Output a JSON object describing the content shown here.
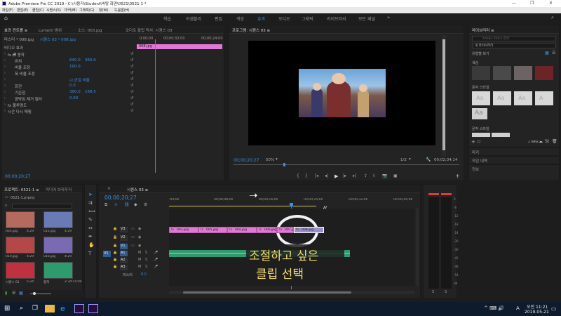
{
  "window": {
    "title": "Adobe Premiere Pro CC 2019 - C:\\사용자\\Student\\바탕 화면\\0521\\0521-1 *",
    "menu": [
      "파일(F)",
      "편집(E)",
      "클립(C)",
      "시퀀스(S)",
      "마커(M)",
      "그래픽(G)",
      "창(W)",
      "도움말(H)"
    ],
    "controls": [
      "—",
      "❐",
      "✕"
    ]
  },
  "workspaces": [
    "학습",
    "어셈블리",
    "편집",
    "색상",
    "효과",
    "오디오",
    "그래픽",
    "라이브러리",
    "모든 패널"
  ],
  "workspace_active": "효과",
  "effect_controls": {
    "tabs": [
      "효과 컨트롤 ≡",
      "Lumetri 범위",
      "소스: 003.jpg",
      "오디오 클립 믹서: 시퀀스 03"
    ],
    "breadcrumb": "마스터 * 008.jpg",
    "seq_breadcrumb": "시퀀스 03 * 008.jpg",
    "time_start": "0;00;00",
    "time_mid": "00;00;32;00",
    "time_end": "00;00;24;00",
    "clip_bar": "008.jpg",
    "section_video": "비디오 효과",
    "rows": [
      {
        "label": "fx 🗗 동작",
        "v1": "",
        "v2": ""
      },
      {
        "label": "위치",
        "v1": "640.0",
        "v2": "360.0"
      },
      {
        "label": "비율 조정",
        "v1": "100.0",
        "v2": ""
      },
      {
        "label": "폭 비율 조정",
        "v1": "",
        "v2": ""
      },
      {
        "label": "",
        "v1": "☑ 균일 비율",
        "v2": ""
      },
      {
        "label": "회전",
        "v1": "0.0",
        "v2": ""
      },
      {
        "label": "기준점",
        "v1": "300.0",
        "v2": "168.5"
      },
      {
        "label": "깜박임 제거 필터",
        "v1": "0.00",
        "v2": ""
      },
      {
        "label": "fx 불투명도",
        "v1": "",
        "v2": ""
      },
      {
        "label": "시간 다시 매핑",
        "v1": "",
        "v2": ""
      }
    ],
    "footer_time": "00;00;20;27"
  },
  "program": {
    "title": "프로그램: 시퀀스 03 ≡",
    "timecode": "00;00;20;27",
    "fit": "50%",
    "quality": "1/2",
    "duration": "00;02;34;14"
  },
  "libraries": {
    "title": "라이브러리 ≡",
    "search_placeholder": "Adobe Stock 검색",
    "dropdown": "내 라이브러리",
    "view_label": "유형별 보기",
    "colors_title": "색상",
    "colors": [
      "#3a3a3a",
      "#4a4a4a",
      "#6b6463",
      "#6e2327"
    ],
    "char_styles_title": "문자 스타일",
    "char_styles": [
      "Aa",
      "Aa",
      "Aa",
      "A"
    ],
    "char_extra": "Aa",
    "para_styles_title": "문자 스타일",
    "size_label": "278KB",
    "collapsed": [
      "마커",
      "작업 내역",
      "정보"
    ]
  },
  "project": {
    "tabs": [
      "프로젝트: 0521-1 ≡",
      "미디어 브라우저"
    ],
    "file": "0521-1.prproj",
    "items": [
      {
        "name": "005.jpg",
        "dur": "4:29"
      },
      {
        "name": "015.jpg",
        "dur": "4:29"
      },
      {
        "name": "010.jpg",
        "dur": "4:29"
      },
      {
        "name": "016.jpg",
        "dur": "4:29"
      },
      {
        "name": "시퀀스 01",
        "dur": "5:24"
      },
      {
        "name": "캡쳐",
        "dur": "2:34:15:04"
      }
    ]
  },
  "timeline": {
    "tab_close": "✕",
    "title": "시퀀스 03 ≡",
    "timecode": "00;00;20;27",
    "ruler": [
      ":00;00",
      "00;00;08;00",
      "00;00;16;00",
      "00;00;24;00",
      "00;00;32;00",
      "00;00;40;00"
    ],
    "video_tracks": [
      "V3",
      "V2",
      "V1"
    ],
    "audio_tracks": [
      "A1",
      "A2",
      "A3"
    ],
    "master_label": "마스터",
    "master_value": "0.0",
    "source_v": "V1",
    "source_a": "A1",
    "clips": [
      {
        "name": "003.jpg"
      },
      {
        "name": "005.jpg"
      },
      {
        "name": "004.jpg"
      },
      {
        "name": "006.jpg"
      },
      {
        "name": "007.jpg"
      },
      {
        "name": "008.jpg"
      }
    ],
    "annotation": [
      "조절하고 싶은",
      "클립 선택"
    ]
  },
  "meter": {
    "scale": [
      "0",
      "-6",
      "-12",
      "-18",
      "-24",
      "-30",
      "-36",
      "-42",
      "-48",
      "-54",
      "dB"
    ],
    "bottom": [
      "S",
      "S"
    ]
  },
  "taskbar": {
    "time": "오전 11:21",
    "date": "2019-05-21",
    "lang": "A",
    "tray": "^ ⌨ 🔊"
  }
}
